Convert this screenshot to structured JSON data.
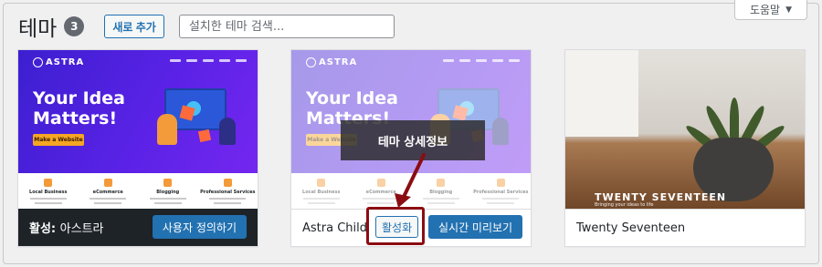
{
  "header": {
    "title": "테마",
    "count": "3",
    "add_new": "새로 추가",
    "search_placeholder": "설치한 테마 검색..."
  },
  "help": {
    "label": "도움말"
  },
  "astra_preview": {
    "logo": "ASTRA",
    "hero_line1": "Your Idea",
    "hero_line2": "Matters!",
    "hero_button": "Make a Website",
    "features": [
      "Local Business",
      "eCommerce",
      "Blogging",
      "Professional Services"
    ]
  },
  "themes": [
    {
      "name_prefix": "활성:",
      "name": "아스트라",
      "customize_label": "사용자 정의하기"
    },
    {
      "name": "Astra Child",
      "details_label": "테마 상세정보",
      "activate_label": "활성화",
      "preview_label": "실시간 미리보기"
    },
    {
      "name": "Twenty Seventeen",
      "preview_title": "TWENTY SEVENTEEN",
      "preview_tagline": "Bringing your ideas to life"
    }
  ],
  "colors": {
    "primary": "#2271b1",
    "active_bar": "#1d2327",
    "highlight": "#8b0d12"
  }
}
